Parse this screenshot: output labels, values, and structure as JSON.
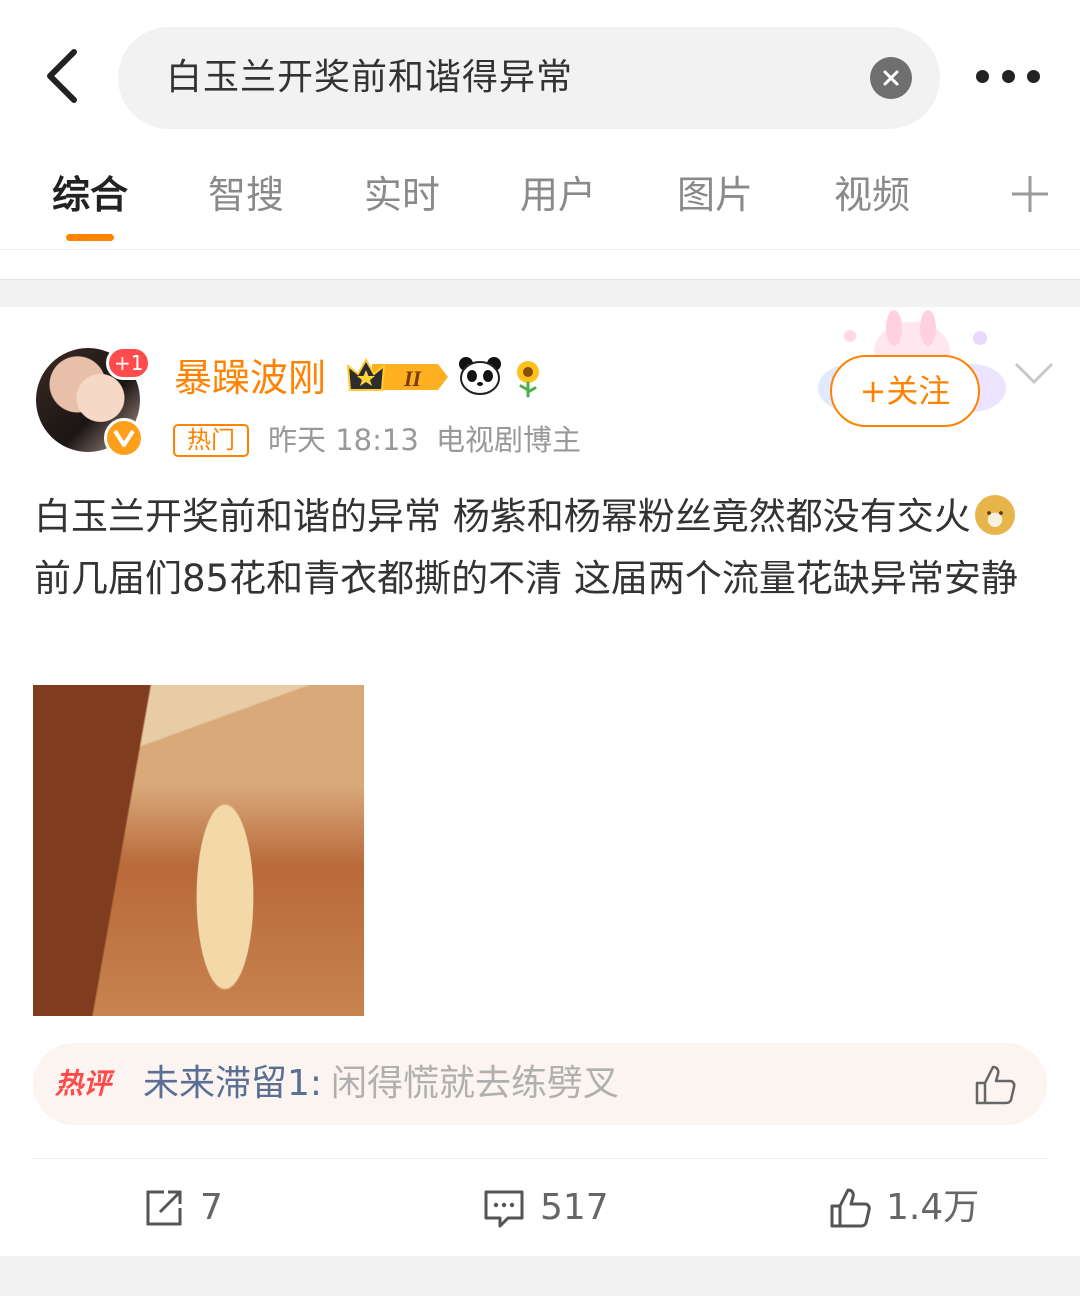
{
  "search": {
    "query": "白玉兰开奖前和谐得异常"
  },
  "tabs": [
    "综合",
    "智搜",
    "实时",
    "用户",
    "图片",
    "视频"
  ],
  "accent": "#ff8200",
  "post": {
    "avatar_badge": "+1",
    "username": "暴躁波刚",
    "hot_tag": "热门",
    "time": "昨天 18:13",
    "role": "电视剧博主",
    "follow_label": "+关注",
    "text_part1": "白玉兰开奖前和谐的异常 杨紫和杨幂粉丝竟然都没有交火",
    "text_part2": " 前几届们85花和青衣都撕的不清 这届两个流量花缺异常安静",
    "hot_comment": {
      "tag": "热评",
      "user": "未来滞留1:",
      "text": " 闲得慌就去练劈叉"
    },
    "actions": {
      "repost": "7",
      "comment": "517",
      "like": "1.4万"
    }
  }
}
